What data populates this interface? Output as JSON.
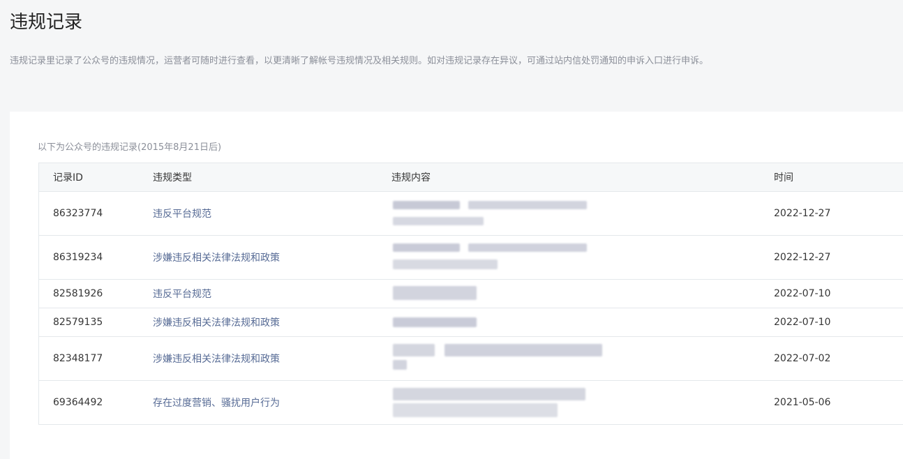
{
  "page": {
    "title": "违规记录",
    "description": "违规记录里记录了公众号的违规情况，运营者可随时进行查看，以更清晰了解帐号违规情况及相关规则。如对违规记录存在异议，可通过站内信处罚通知的申诉入口进行申诉。"
  },
  "table": {
    "caption": "以下为公众号的违规记录(2015年8月21日后)",
    "headers": {
      "id": "记录ID",
      "type": "违规类型",
      "content": "违规内容",
      "time": "时间"
    },
    "rows": [
      {
        "id": "86323774",
        "type": "违反平台规范",
        "time": "2022-12-27"
      },
      {
        "id": "86319234",
        "type": "涉嫌违反相关法律法规和政策",
        "time": "2022-12-27"
      },
      {
        "id": "82581926",
        "type": "违反平台规范",
        "time": "2022-07-10"
      },
      {
        "id": "82579135",
        "type": "涉嫌违反相关法律法规和政策",
        "time": "2022-07-10"
      },
      {
        "id": "82348177",
        "type": "涉嫌违反相关法律法规和政策",
        "time": "2022-07-02"
      },
      {
        "id": "69364492",
        "type": "存在过度营销、骚扰用户行为",
        "time": "2021-05-06"
      }
    ]
  },
  "colors": {
    "link": "#576b95",
    "border": "#e4e8eb",
    "header_bg": "#f6f8f9",
    "muted_text": "#8b8f99",
    "blur_mask": "#c9cbd6"
  }
}
